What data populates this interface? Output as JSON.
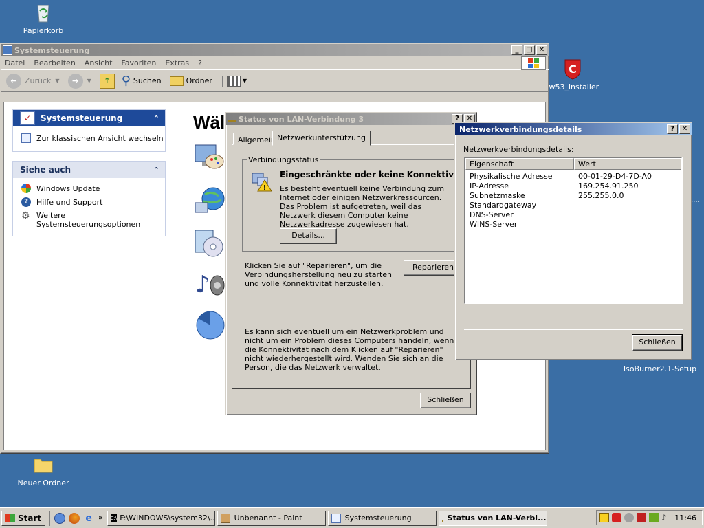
{
  "desktop": {
    "icons": [
      {
        "label": "Papierkorb"
      },
      {
        "label": "fw53_installer"
      },
      {
        "label": "IsoBurner2.1-Setup"
      },
      {
        "label": "Neuer Ordner"
      }
    ]
  },
  "control_panel": {
    "title": "Systemsteuerung",
    "menu": [
      "Datei",
      "Bearbeiten",
      "Ansicht",
      "Favoriten",
      "Extras",
      "?"
    ],
    "toolbar": {
      "back": "Zurück",
      "search": "Suchen",
      "folders": "Ordner"
    },
    "panel_main": {
      "title": "Systemsteuerung",
      "link": "Zur klassischen Ansicht wechseln"
    },
    "panel_see_also": {
      "title": "Siehe auch",
      "items": [
        "Windows Update",
        "Hilfe und Support",
        "Weitere Systemsteuerungsoptionen"
      ]
    },
    "heading_partial": "Wäl"
  },
  "lan_dialog": {
    "title": "Status von LAN-Verbindung 3",
    "tabs": [
      "Allgemein",
      "Netzwerkunterstützung"
    ],
    "group_title": "Verbindungsstatus",
    "status_heading": "Eingeschränkte oder keine Konnektivität",
    "status_text": "Es besteht eventuell keine Verbindung zum Internet oder einigen Netzwerkressourcen. Das Problem ist aufgetreten, weil das Netzwerk diesem Computer keine Netzwerkadresse zugewiesen hat.",
    "details_button": "Details...",
    "repair_text": "Klicken Sie auf \"Reparieren\", um die Verbindungsherstellung neu zu starten und volle Konnektivität herzustellen.",
    "repair_button": "Reparieren",
    "hint_text": "Es kann sich eventuell um ein Netzwerkproblem und nicht um ein Problem dieses Computers handeln, wenn die Konnektivität nach dem Klicken auf \"Reparieren\" nicht wiederhergestellt wird. Wenden Sie sich an die Person, die das Netzwerk verwaltet.",
    "close_button": "Schließen"
  },
  "details_dialog": {
    "title": "Netzwerkverbindungsdetails",
    "label": "Netzwerkverbindungsdetails:",
    "columns": [
      "Eigenschaft",
      "Wert"
    ],
    "rows": [
      {
        "property": "Physikalische Adresse",
        "value": "00-01-29-D4-7D-A0"
      },
      {
        "property": "IP-Adresse",
        "value": "169.254.91.250"
      },
      {
        "property": "Subnetzmaske",
        "value": "255.255.0.0"
      },
      {
        "property": "Standardgateway",
        "value": ""
      },
      {
        "property": "DNS-Server",
        "value": ""
      },
      {
        "property": "WINS-Server",
        "value": ""
      }
    ],
    "close_button": "Schließen"
  },
  "taskbar": {
    "start": "Start",
    "tasks": [
      {
        "label": "F:\\WINDOWS\\system32\\..."
      },
      {
        "label": "Unbenannt - Paint"
      },
      {
        "label": "Systemsteuerung"
      },
      {
        "label": "Status von LAN-Verbi..."
      }
    ],
    "clock": "11:46"
  }
}
